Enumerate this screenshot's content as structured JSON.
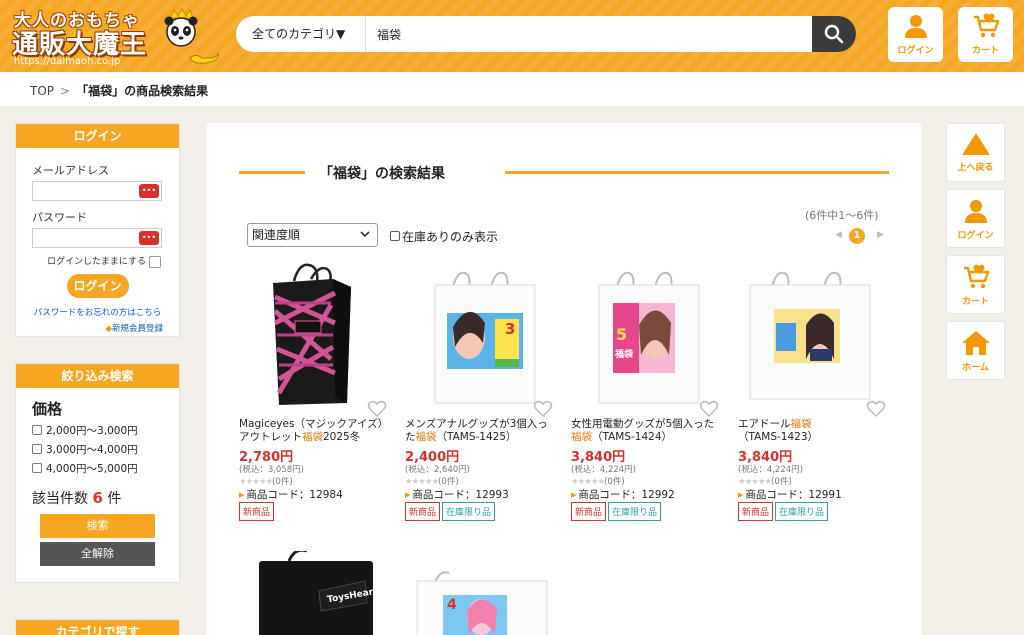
{
  "header": {
    "logo_top": "大人のおもちゃ",
    "logo_main": "通販大魔王",
    "logo_url": "https://daimaoh.co.jp",
    "search_category": "全てのカテゴリ▼",
    "search_value": "福袋",
    "login_label": "ログイン",
    "cart_label": "カート"
  },
  "breadcrumb": {
    "top": "TOP",
    "sep": ">",
    "current": "「福袋」の商品検索結果"
  },
  "sidebar": {
    "login": {
      "title": "ログイン",
      "email_label": "メールアドレス",
      "password_label": "パスワード",
      "dots": "•••",
      "remember": "ログインしたままにする",
      "button": "ログイン",
      "forgot": "パスワードをお忘れの方はこちら",
      "register": "新規会員登録",
      "register_mark": "◆"
    },
    "filter": {
      "title": "絞り込み検索",
      "price_title": "価格",
      "price_options": [
        "2,000円～3,000円",
        "3,000円～4,000円",
        "4,000円～5,000円"
      ],
      "hit_prefix": "該当件数",
      "hit_count": "6",
      "hit_suffix": "件",
      "search_button": "検索",
      "clear_button": "全解除"
    },
    "category": {
      "title": "カテゴリで探す"
    }
  },
  "main": {
    "result_title": "「福袋」の検索結果",
    "count_text": "(6件中1～6件)",
    "current_page": "1",
    "sort_value": "関連度順",
    "stock_filter_label": "在庫ありのみ表示"
  },
  "products": [
    {
      "name_pre": "Magiceyes（マジックアイズ）アウトレット",
      "name_hl": "福袋",
      "name_post": "2025冬",
      "price": "2,780円",
      "tax": "(税込：3,058円)",
      "rating_count": "(0件)",
      "code": "商品コード：12984",
      "tags": [
        "新商品"
      ]
    },
    {
      "name_pre": "メンズアナルグッズが3個入った",
      "name_hl": "福袋",
      "name_post": "（TAMS-1425）",
      "price": "2,400円",
      "tax": "(税込：2,640円)",
      "rating_count": "(0件)",
      "code": "商品コード：12993",
      "tags": [
        "新商品",
        "在庫限り品"
      ]
    },
    {
      "name_pre": "女性用電動グッズが5個入った",
      "name_hl": "福袋",
      "name_post": "（TAMS-1424）",
      "price": "3,840円",
      "tax": "(税込：4,224円)",
      "rating_count": "(0件)",
      "code": "商品コード：12992",
      "tags": [
        "新商品",
        "在庫限り品"
      ]
    },
    {
      "name_pre": "エアドール",
      "name_hl": "福袋",
      "name_post": "（TAMS-1423）",
      "price": "3,840円",
      "tax": "(税込：4,224円)",
      "rating_count": "(0件)",
      "code": "商品コード：12991",
      "tags": [
        "新商品",
        "在庫限り品"
      ]
    }
  ],
  "bag_labels": {
    "brand_bag": "ToysHeart",
    "p2_num": "3",
    "p3_num": "5",
    "p3_word": "福袋",
    "p6_num": "4"
  },
  "right_nav": {
    "top": "上へ戻る",
    "login": "ログイン",
    "cart": "カート",
    "home": "ホーム"
  },
  "colors": {
    "accent": "#f6a623",
    "price_red": "#d8312b",
    "tag_teal": "#2aa3a8",
    "link_blue": "#0a5ab1"
  }
}
